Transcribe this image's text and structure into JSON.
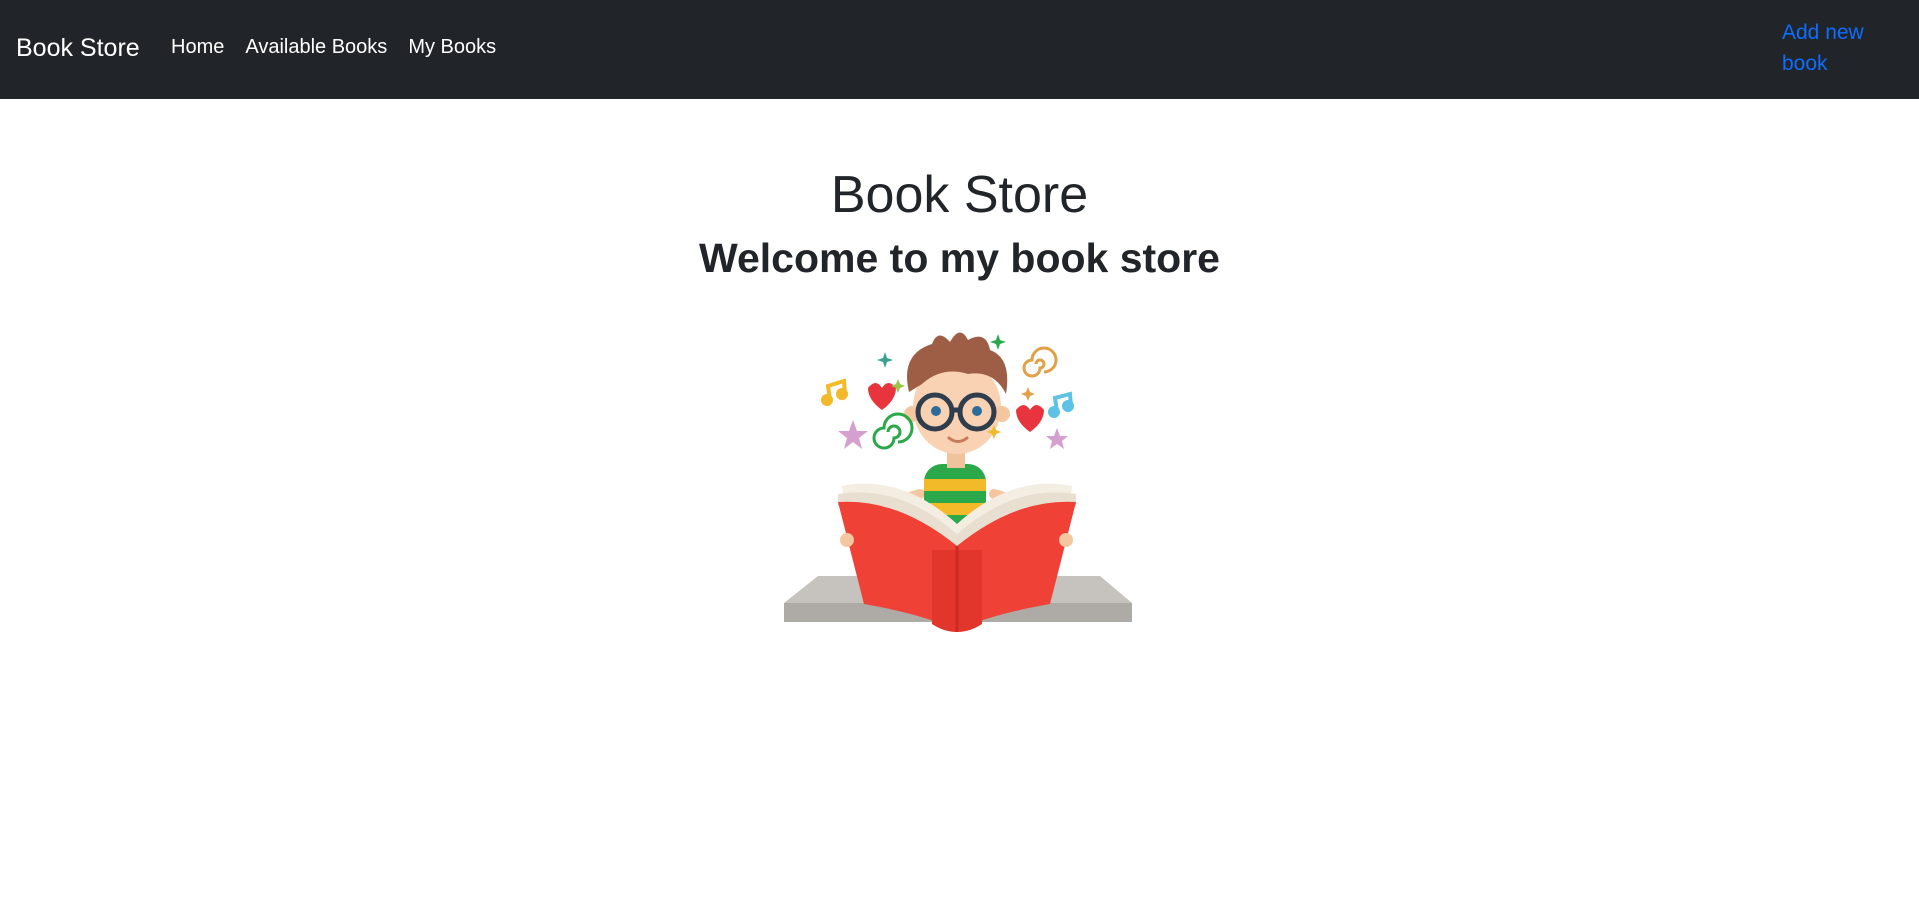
{
  "navbar": {
    "brand": "Book Store",
    "links": [
      "Home",
      "Available Books",
      "My Books"
    ],
    "add_link": "Add new book",
    "background": "#212529",
    "add_link_color": "#0d6efd"
  },
  "main": {
    "title": "Book Store",
    "subtitle": "Welcome to my book store",
    "illustration": "boy-reading-book-illustration"
  }
}
